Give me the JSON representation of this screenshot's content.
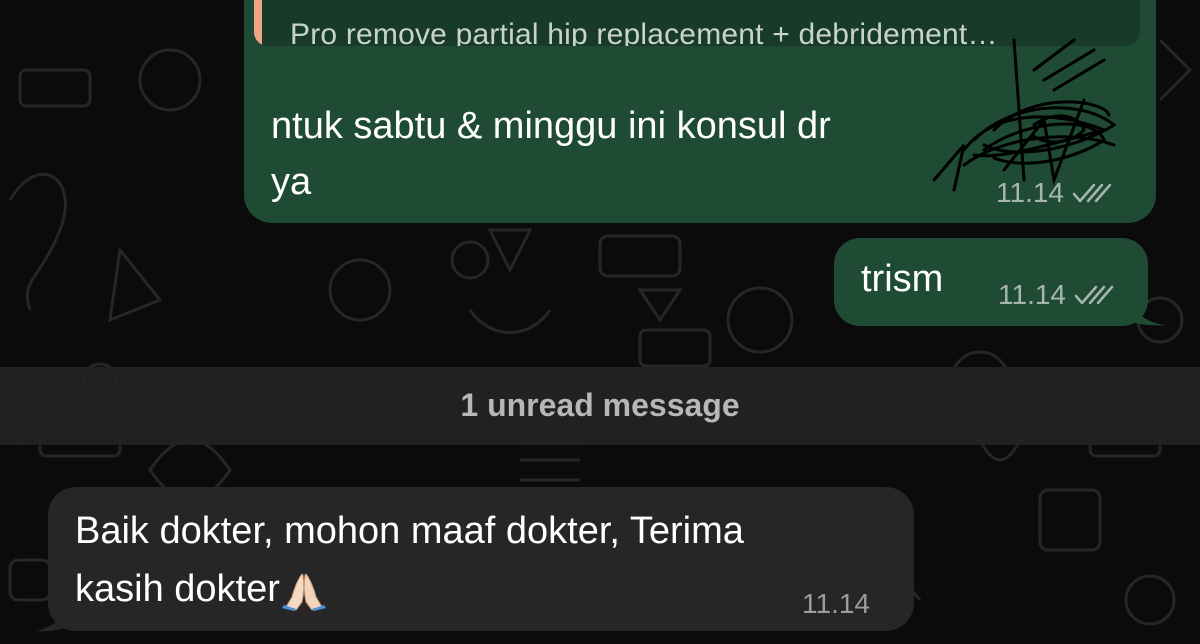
{
  "messages": {
    "outgoing_reply": {
      "quoted_preview": "Pro remove partial hip replacement + debridement…",
      "text": "ntuk sabtu & minggu ini konsul dr",
      "text_line2": "ya",
      "time": "11.14",
      "status": "read"
    },
    "outgoing_trism": {
      "text": "trism",
      "time": "11.14",
      "status": "read"
    },
    "unread_separator": "1 unread message",
    "incoming": {
      "text_line1": "Baik dokter, mohon maaf dokter, Terima",
      "text_line2": "kasih dokter",
      "emoji": "folded-hands",
      "time": "11.14"
    }
  },
  "colors": {
    "background": "#0b0b0b",
    "outgoing_bubble": "#1f4a34",
    "quote_box": "#183a29",
    "quote_accent": "#f1a68a",
    "incoming_bubble": "#262626",
    "unread_band": "#232323",
    "meta_text": "#a7b6ac"
  }
}
